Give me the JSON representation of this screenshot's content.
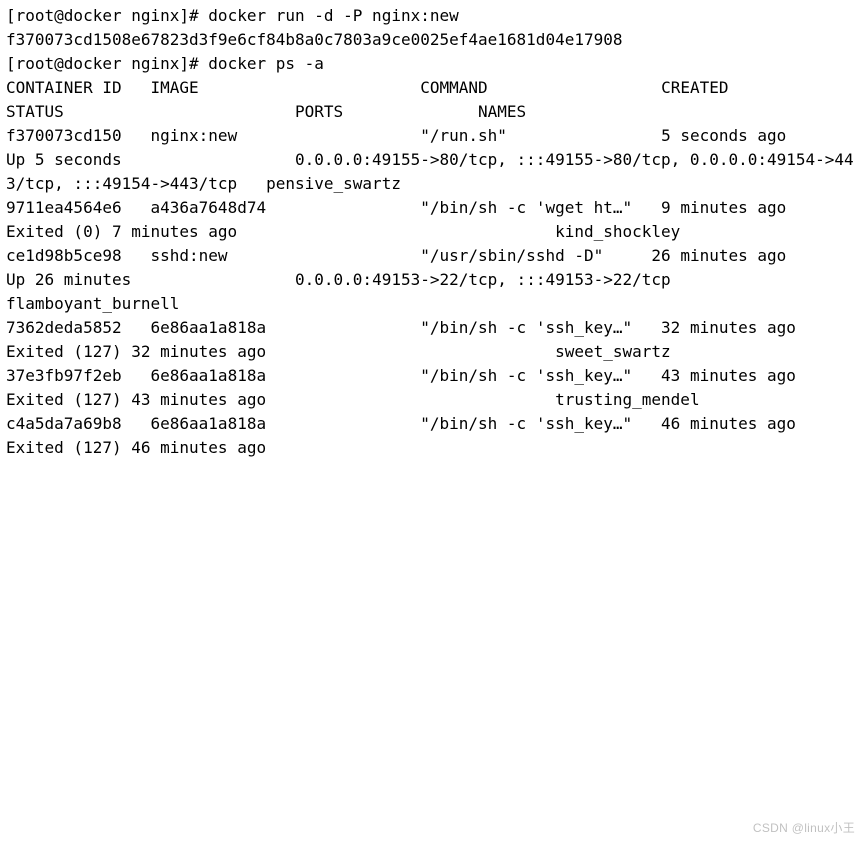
{
  "prompt": "[root@docker nginx]#",
  "commands": {
    "run": "docker run -d -P nginx:new",
    "run_output": "f370073cd1508e67823d3f9e6cf84b8a0c7803a9ce0025ef4ae1681d04e17908",
    "ps": "docker ps -a"
  },
  "ps_headers": {
    "container_id": "CONTAINER ID",
    "image": "IMAGE",
    "command": "COMMAND",
    "created": "CREATED",
    "status": "STATUS",
    "ports": "PORTS",
    "names": "NAMES"
  },
  "containers": [
    {
      "id": "f370073cd150",
      "image": "nginx:new",
      "command": "\"/run.sh\"",
      "created": "5 seconds ago",
      "status": "Up 5 seconds",
      "ports": "0.0.0.0:49155->80/tcp, :::49155->80/tcp, 0.0.0.0:49154->443/tcp, :::49154->443/tcp",
      "names": "pensive_swartz"
    },
    {
      "id": "9711ea4564e6",
      "image": "a436a7648d74",
      "command": "\"/bin/sh -c 'wget ht…\"",
      "created": "9 minutes ago",
      "status": "Exited (0) 7 minutes ago",
      "ports": "",
      "names": "kind_shockley"
    },
    {
      "id": "ce1d98b5ce98",
      "image": "sshd:new",
      "command": "\"/usr/sbin/sshd -D\"",
      "created": "26 minutes ago",
      "status": "Up 26 minutes",
      "ports": "0.0.0.0:49153->22/tcp, :::49153->22/tcp",
      "names": "flamboyant_burnell"
    },
    {
      "id": "7362deda5852",
      "image": "6e86aa1a818a",
      "command": "\"/bin/sh -c 'ssh_key…\"",
      "created": "32 minutes ago",
      "status": "Exited (127) 32 minutes ago",
      "ports": "",
      "names": "sweet_swartz"
    },
    {
      "id": "37e3fb97f2eb",
      "image": "6e86aa1a818a",
      "command": "\"/bin/sh -c 'ssh_key…\"",
      "created": "43 minutes ago",
      "status": "Exited (127) 43 minutes ago",
      "ports": "",
      "names": "trusting_mendel"
    },
    {
      "id": "c4a5da7a69b8",
      "image": "6e86aa1a818a",
      "command": "\"/bin/sh -c 'ssh_key…\"",
      "created": "46 minutes ago",
      "status": "Exited (127) 46 minutes ago",
      "ports": "",
      "names": ""
    }
  ],
  "watermark": "CSDN @linux小王"
}
